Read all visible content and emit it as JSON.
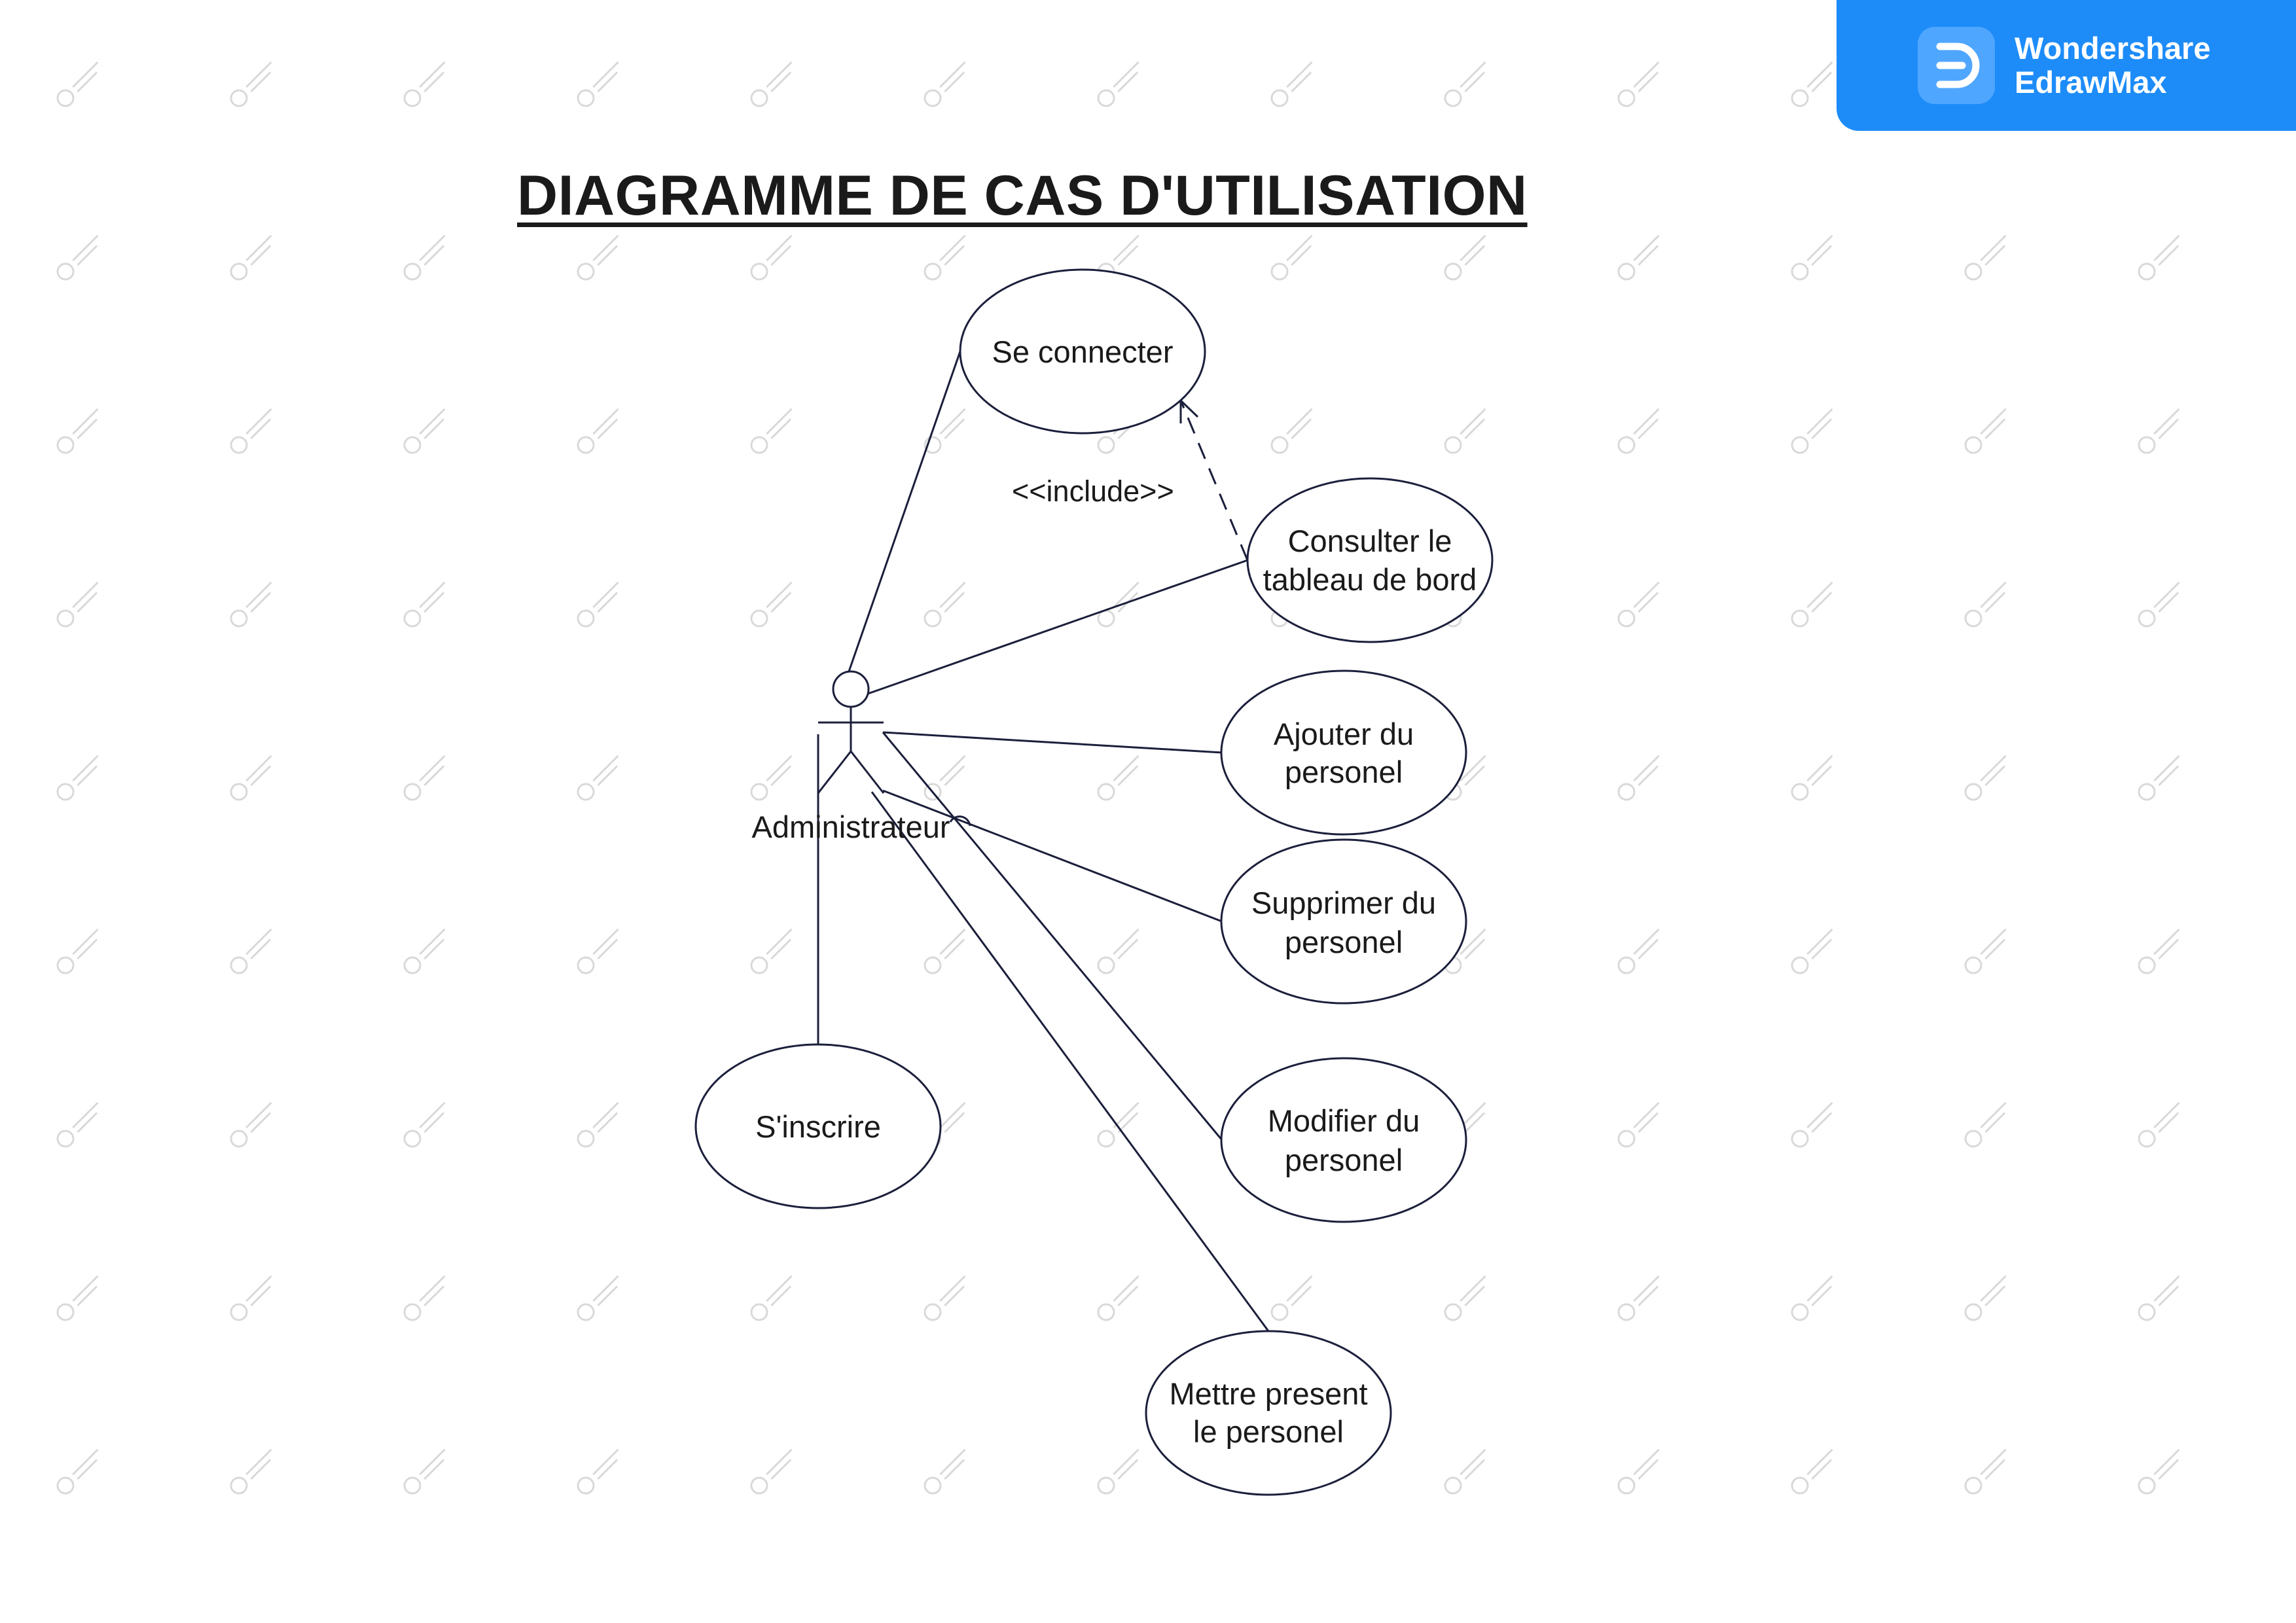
{
  "title": "DIAGRAMME DE CAS D'UTILISATION",
  "brand": {
    "line1": "Wondershare",
    "line2": "EdrawMax",
    "icon": "edrawmax-logo-icon",
    "color": "#1d8cf8"
  },
  "actor": {
    "label": "Administrateur",
    "icon": "stick-figure-icon"
  },
  "use_cases": {
    "se_connecter": [
      "Se connecter"
    ],
    "consulter": [
      "Consulter le",
      "tableau de bord"
    ],
    "ajouter": [
      "Ajouter du",
      "personel"
    ],
    "supprimer": [
      "Supprimer du",
      "personel"
    ],
    "modifier": [
      "Modifier du",
      "personel"
    ],
    "mettre_present": [
      "Mettre present",
      "le personel"
    ],
    "inscrire": [
      "S'inscrire"
    ]
  },
  "relations": {
    "include_label": "<<include>>"
  },
  "colors": {
    "line": "#1b1f3b",
    "text": "#1a1a1a",
    "watermark": "#d9d9d9"
  }
}
